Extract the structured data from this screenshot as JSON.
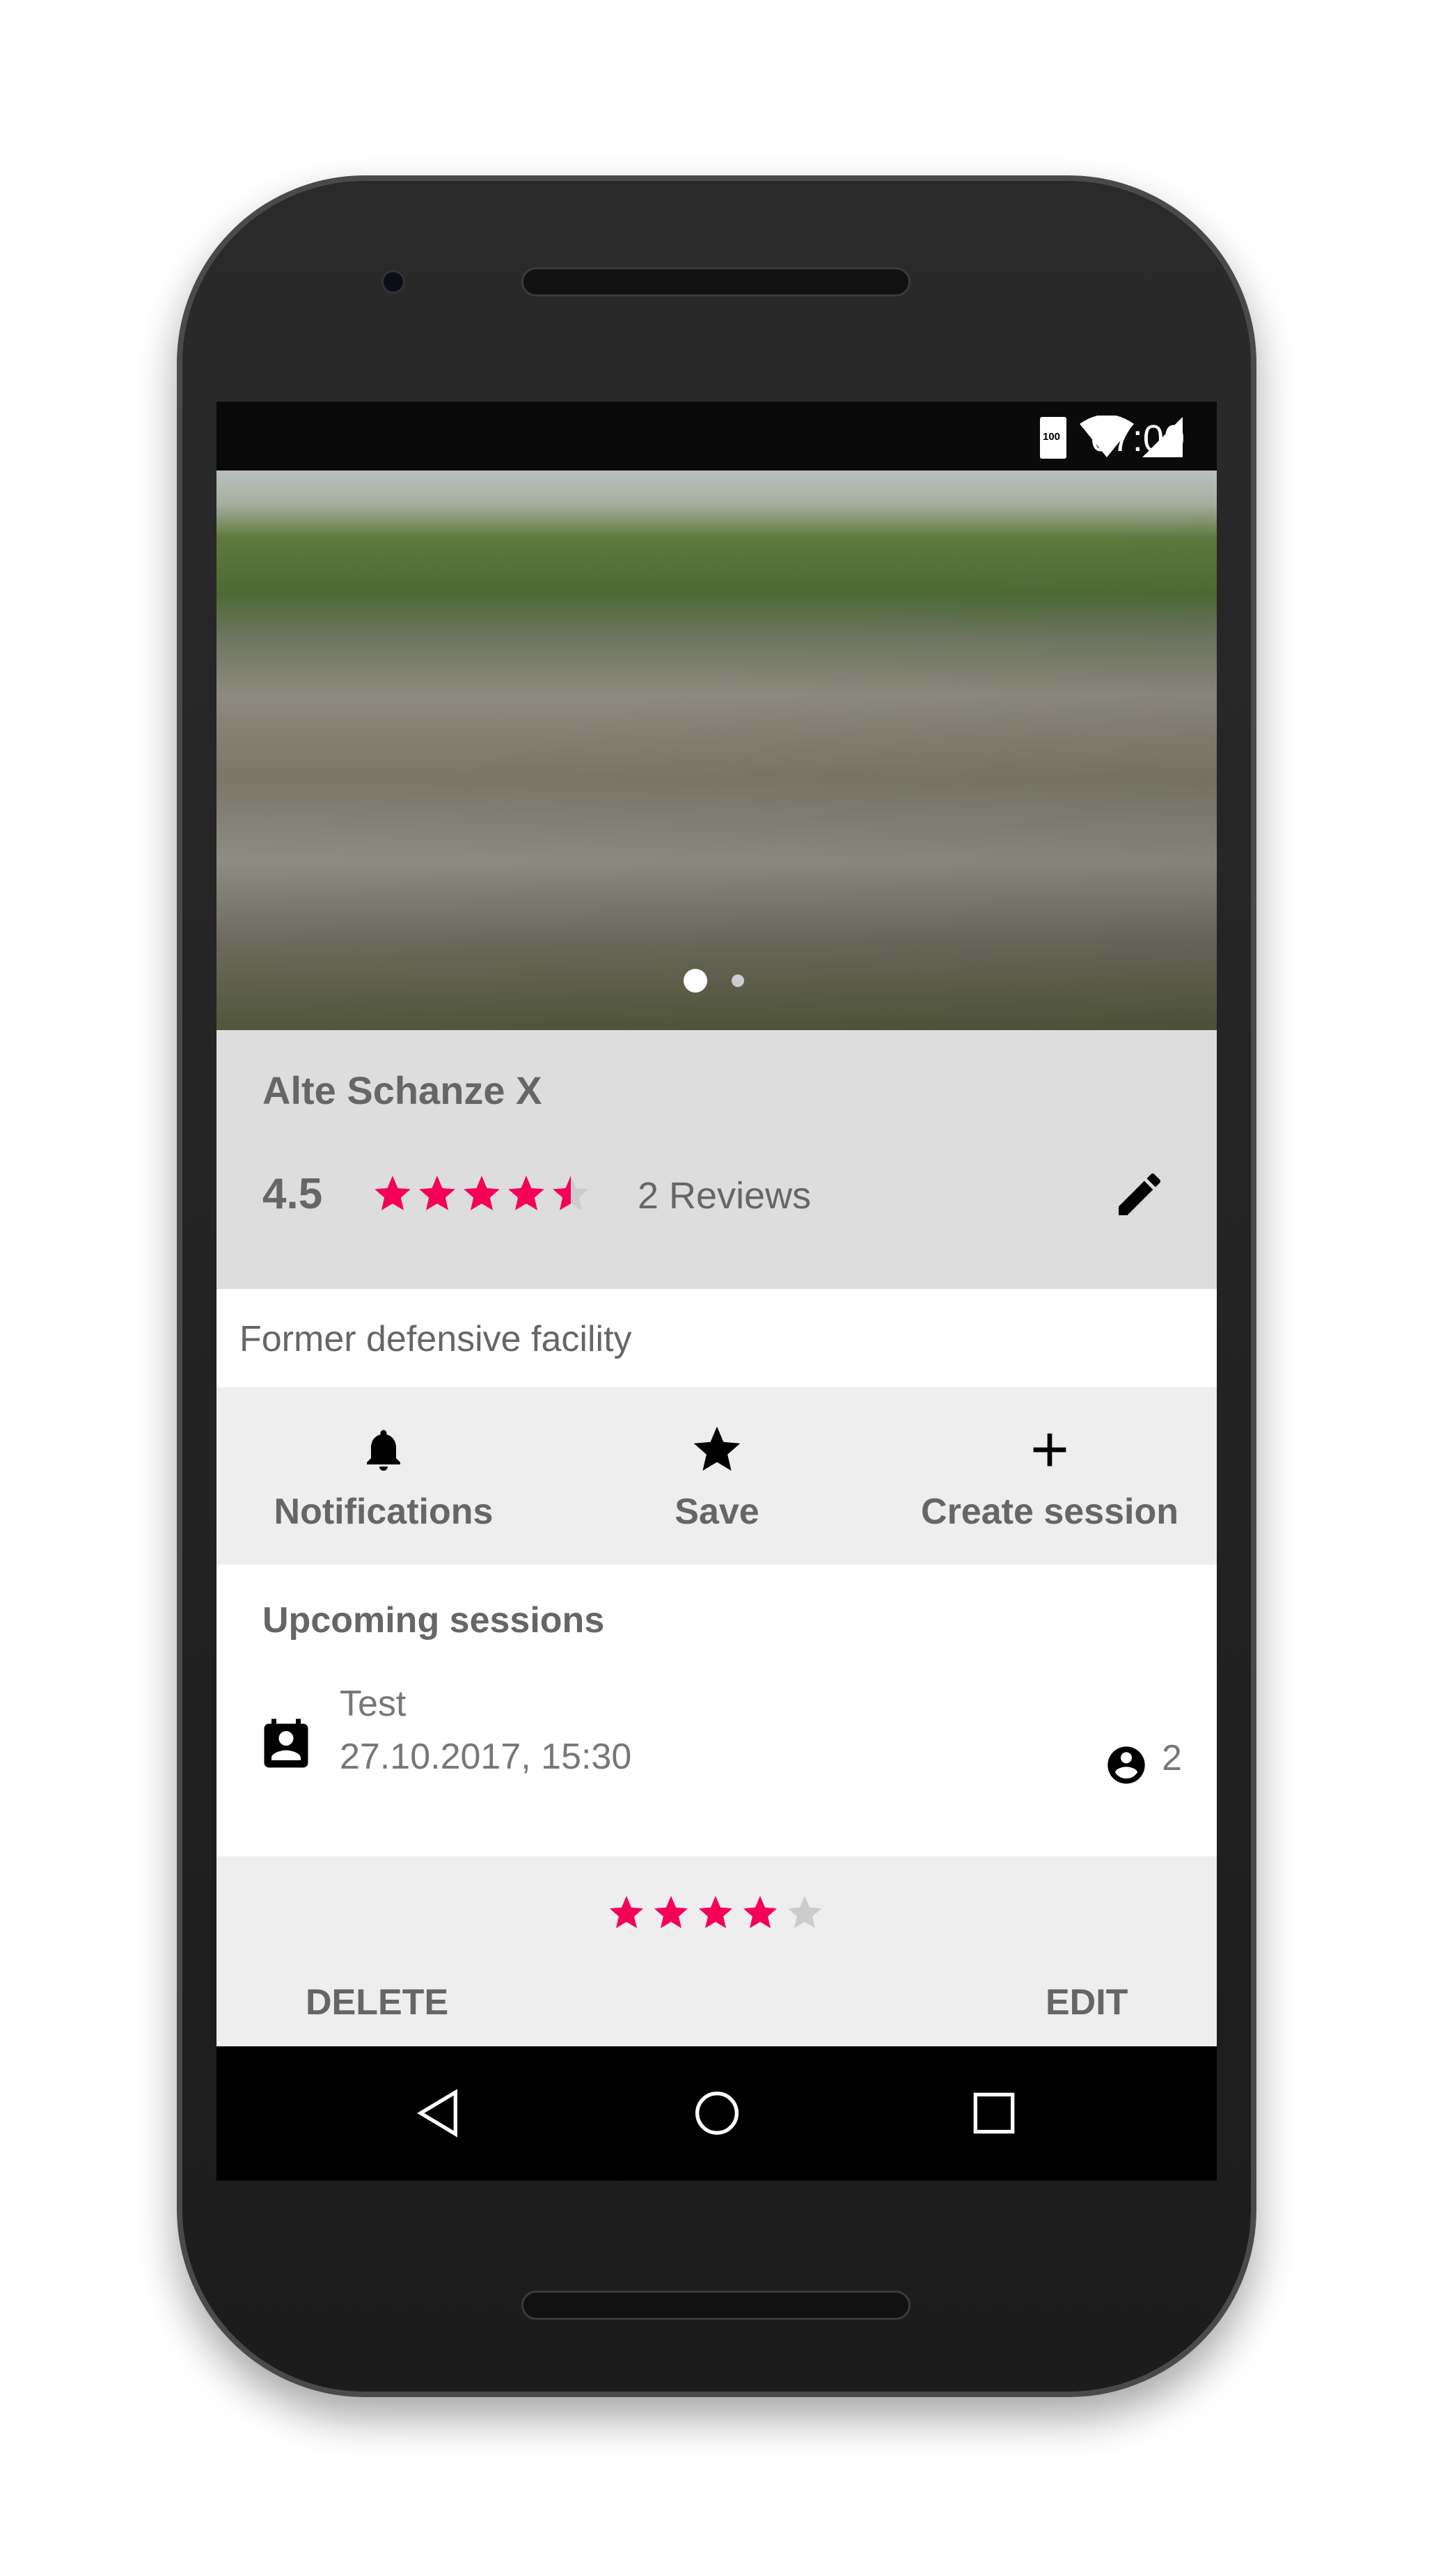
{
  "status_bar": {
    "time": "07:00",
    "battery": "100",
    "icons": [
      "wifi-icon",
      "signal-icon",
      "battery-icon"
    ]
  },
  "gallery": {
    "page_count": 2,
    "current_page": 1
  },
  "spot": {
    "title": "Alte Schanze X",
    "rating": "4.5",
    "rating_value": 4.5,
    "reviews": "2 Reviews",
    "description": "Former defensive facility"
  },
  "actions": [
    {
      "label": "Notifications",
      "icon": "bell-icon"
    },
    {
      "label": "Save",
      "icon": "star-icon"
    },
    {
      "label": "Create session",
      "icon": "plus-icon"
    }
  ],
  "upcoming": {
    "heading": "Upcoming sessions",
    "sessions": [
      {
        "name": "Test",
        "datetime": "27.10.2017, 15:30",
        "participants": "2"
      }
    ]
  },
  "review": {
    "rating_value": 4,
    "delete_label": "DELETE",
    "edit_label": "EDIT"
  },
  "colors": {
    "accent": "#f50057",
    "star_empty": "#cccccc",
    "header_bg": "#dddddd",
    "section_bg": "#eeeeee"
  }
}
